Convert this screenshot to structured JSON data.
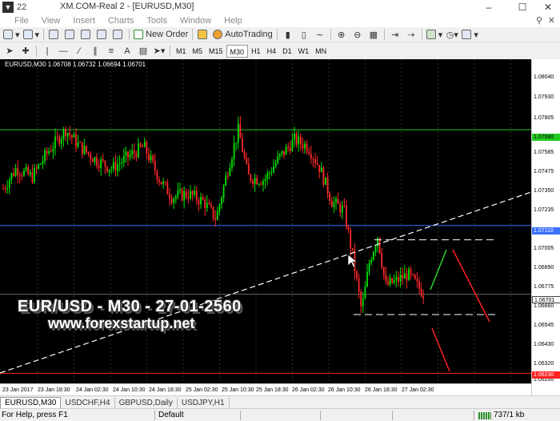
{
  "window": {
    "app_number": "22",
    "title": "XM.COM-Real 2 - [EURUSD,M30]",
    "minimize": "–",
    "maximize": "☐",
    "close": "✕"
  },
  "menu": {
    "items": [
      "File",
      "View",
      "Insert",
      "Charts",
      "Tools",
      "Window",
      "Help"
    ],
    "search_icon": "magnifier-icon",
    "close_child": "✕"
  },
  "toolbar": {
    "new_order": "New Order",
    "auto_trading": "AutoTrading"
  },
  "timeframes": [
    "M1",
    "M5",
    "M15",
    "M30",
    "H1",
    "H4",
    "D1",
    "W1",
    "MN"
  ],
  "active_timeframe": "M30",
  "chart": {
    "info": "EURUSD,M30  1.06708 1.06732 1.06694 1.06701",
    "price_labels": [
      "1.08040",
      "1.07930",
      "1.07805",
      "1.07585",
      "1.07475",
      "1.07350",
      "1.07235",
      "1.07005",
      "1.06890",
      "1.06775",
      "1.06660",
      "1.06545",
      "1.06430",
      "1.06320",
      "1.06200"
    ],
    "level_tags": {
      "green": "1.07680",
      "blue": "1.07110",
      "current": "1.06701",
      "red": "1.06230"
    },
    "time_labels": [
      "23 Jan 2017",
      "23 Jan 18:30",
      "24 Jan 02:30",
      "24 Jan 10:30",
      "24 Jan 18:30",
      "25 Jan 02:30",
      "25 Jan 10:30",
      "25 Jan 18:30",
      "26 Jan 02:30",
      "26 Jan 10:30",
      "26 Jan 18:30",
      "27 Jan 02:30"
    ],
    "watermark_title": "EUR/USD - M30 - 27-01-2560",
    "watermark_url": "www.forexstartup.net",
    "colors": {
      "background": "#000000",
      "bull": "#00e600",
      "bear": "#ff2a2a",
      "grid": "#1e3a1e",
      "green_level": "#22cc22",
      "blue_level": "#3a6fff",
      "red_level": "#ff2020"
    }
  },
  "tabs": [
    "EURUSD,M30",
    "USDCHF,H4",
    "GBPUSD,Daily",
    "USDJPY,H1"
  ],
  "status": {
    "help": "For Help, press F1",
    "profile": "Default",
    "traffic": "737/1 kb"
  }
}
